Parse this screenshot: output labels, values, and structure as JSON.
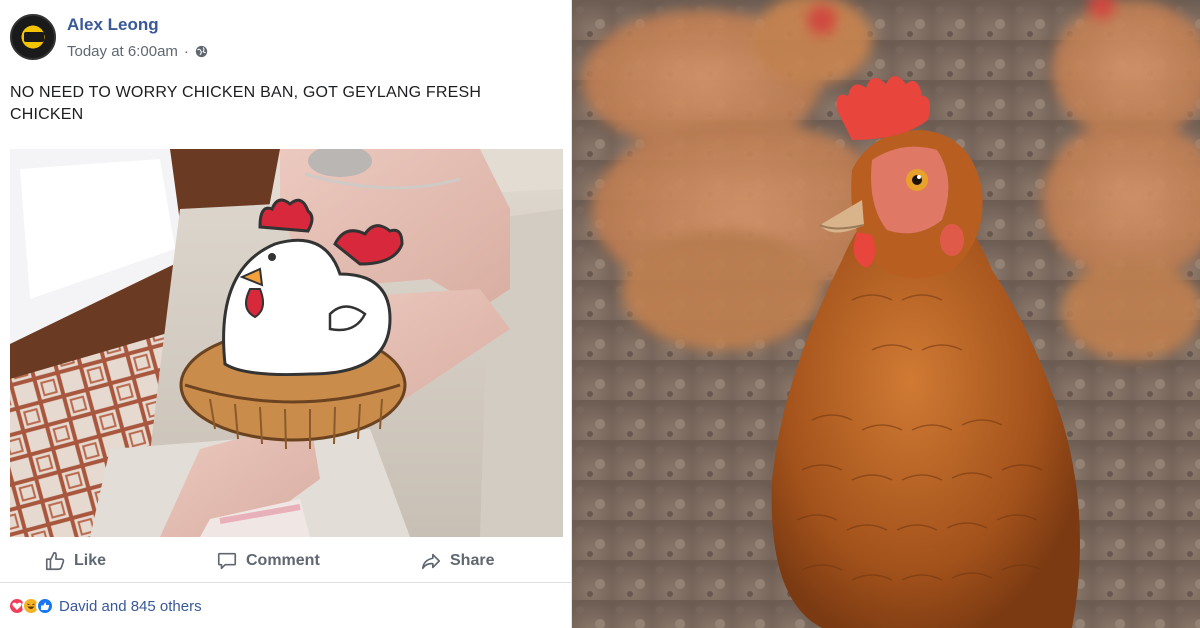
{
  "post": {
    "author": "Alex Leong",
    "timestamp": "Today at 6:00am",
    "privacy_icon": "globe-icon",
    "text": "NO NEED TO WORRY CHICKEN BAN, GOT GEYLANG FRESH CHICKEN",
    "actions": {
      "like_label": "Like",
      "comment_label": "Comment",
      "share_label": "Share"
    },
    "reactions": {
      "icons": [
        "love-reaction-icon",
        "haha-reaction-icon",
        "like-reaction-icon"
      ],
      "summary": "David and 845 others"
    }
  },
  "colors": {
    "facebook_link": "#385898",
    "meta_gray": "#606770",
    "love": "#f33e58",
    "haha": "#f7b125",
    "like": "#1877f2",
    "hen": "#b45a1f",
    "comb": "#e8453c"
  }
}
